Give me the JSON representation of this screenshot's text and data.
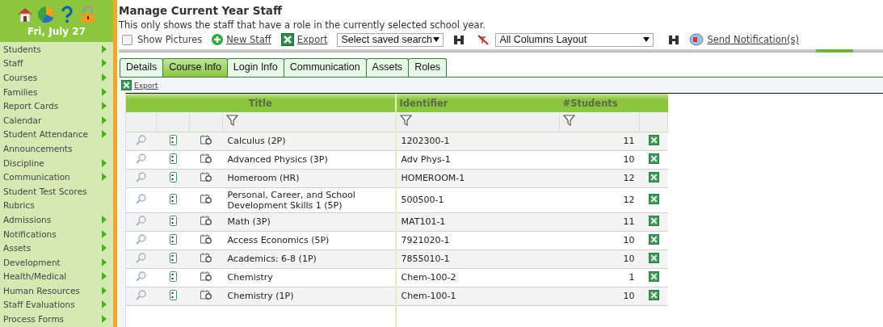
{
  "sidebar": {
    "date": "Fri, July 27",
    "items": [
      {
        "label": "Students",
        "has_submenu": true
      },
      {
        "label": "Staff",
        "has_submenu": true
      },
      {
        "label": "Courses",
        "has_submenu": true
      },
      {
        "label": "Families",
        "has_submenu": true
      },
      {
        "label": "Report Cards",
        "has_submenu": true
      },
      {
        "label": "Calendar",
        "has_submenu": true
      },
      {
        "label": "Student Attendance",
        "has_submenu": true
      },
      {
        "label": "Announcements",
        "has_submenu": false
      },
      {
        "label": "Discipline",
        "has_submenu": true
      },
      {
        "label": "Communication",
        "has_submenu": true
      },
      {
        "label": "Student Test Scores",
        "has_submenu": false
      },
      {
        "label": "Rubrics",
        "has_submenu": false
      },
      {
        "label": "Admissions",
        "has_submenu": true
      },
      {
        "label": "Notifications",
        "has_submenu": true
      },
      {
        "label": "Assets",
        "has_submenu": true
      },
      {
        "label": "Development",
        "has_submenu": true
      },
      {
        "label": "Health/Medical",
        "has_submenu": true
      },
      {
        "label": "Human Resources",
        "has_submenu": true
      },
      {
        "label": "Staff Evaluations",
        "has_submenu": true
      },
      {
        "label": "Process Forms",
        "has_submenu": true
      }
    ]
  },
  "page": {
    "title": "Manage Current Year Staff",
    "subtitle": "This only shows the staff that have a role in the currently selected school year."
  },
  "toolbar": {
    "show_pictures": {
      "label": "Show Pictures",
      "checked": false
    },
    "new_staff": "New Staff",
    "export": "Export",
    "saved_search": "Select saved search",
    "layout": "All Columns Layout",
    "send_notification": "Send Notification(s)"
  },
  "tabs": [
    {
      "label": "Details",
      "selected": false
    },
    {
      "label": "Course Info",
      "selected": true
    },
    {
      "label": "Login Info",
      "selected": false
    },
    {
      "label": "Communication",
      "selected": false
    },
    {
      "label": "Assets",
      "selected": false
    },
    {
      "label": "Roles",
      "selected": false
    }
  ],
  "export_link": "Export",
  "table": {
    "columns": [
      "Title",
      "Identifier",
      "#Students"
    ],
    "rows": [
      {
        "title": "Calculus (2P)",
        "identifier": "1202300-1",
        "students": "11"
      },
      {
        "title": "Advanced Physics (3P)",
        "identifier": "Adv Phys-1",
        "students": "10"
      },
      {
        "title": "Homeroom (HR)",
        "identifier": "HOMEROOM-1",
        "students": "12"
      },
      {
        "title": "Personal, Career, and School Development Skills 1 (5P)",
        "identifier": "500500-1",
        "students": "12"
      },
      {
        "title": "Math (3P)",
        "identifier": "MAT101-1",
        "students": "11"
      },
      {
        "title": "Access Economics (5P)",
        "identifier": "7921020-1",
        "students": "10"
      },
      {
        "title": "Academics: 6-8 (1P)",
        "identifier": "7855010-1",
        "students": "10"
      },
      {
        "title": "Chemistry",
        "identifier": "Chem-100-2",
        "students": "1"
      },
      {
        "title": "Chemistry (1P)",
        "identifier": "Chem-100-1",
        "students": "10"
      }
    ]
  }
}
